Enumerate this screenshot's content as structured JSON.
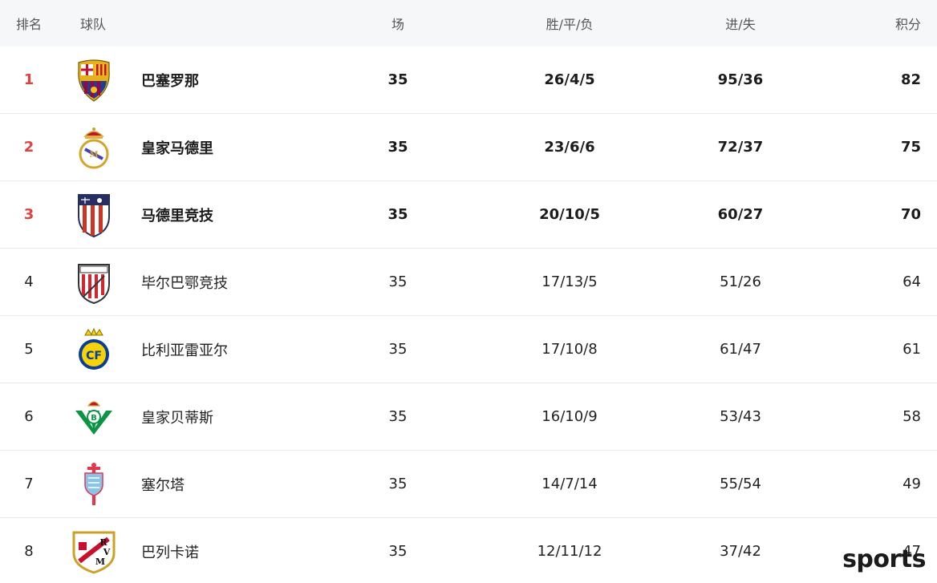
{
  "header": {
    "rank": "排名",
    "team": "球队",
    "played": "场",
    "wdl": "胜/平/负",
    "goals": "进/失",
    "points": "积分"
  },
  "rows": [
    {
      "rank": "1",
      "team": "巴塞罗那",
      "played": "35",
      "wdl": "26/4/5",
      "goals": "95/36",
      "points": "82",
      "logo": "barcelona-crest-icon"
    },
    {
      "rank": "2",
      "team": "皇家马德里",
      "played": "35",
      "wdl": "23/6/6",
      "goals": "72/37",
      "points": "75",
      "logo": "real-madrid-crest-icon"
    },
    {
      "rank": "3",
      "team": "马德里竞技",
      "played": "35",
      "wdl": "20/10/5",
      "goals": "60/27",
      "points": "70",
      "logo": "atletico-madrid-crest-icon"
    },
    {
      "rank": "4",
      "team": "毕尔巴鄂竞技",
      "played": "35",
      "wdl": "17/13/5",
      "goals": "51/26",
      "points": "64",
      "logo": "athletic-club-crest-icon"
    },
    {
      "rank": "5",
      "team": "比利亚雷亚尔",
      "played": "35",
      "wdl": "17/10/8",
      "goals": "61/47",
      "points": "61",
      "logo": "villarreal-crest-icon"
    },
    {
      "rank": "6",
      "team": "皇家贝蒂斯",
      "played": "35",
      "wdl": "16/10/9",
      "goals": "53/43",
      "points": "58",
      "logo": "real-betis-crest-icon"
    },
    {
      "rank": "7",
      "team": "塞尔塔",
      "played": "35",
      "wdl": "14/7/14",
      "goals": "55/54",
      "points": "49",
      "logo": "celta-vigo-crest-icon"
    },
    {
      "rank": "8",
      "team": "巴列卡诺",
      "played": "35",
      "wdl": "12/11/12",
      "goals": "37/42",
      "points": "47",
      "logo": "rayo-vallecano-crest-icon"
    }
  ],
  "colors": {
    "header_bg": "#f6f7f9",
    "top_rank": "#e14141",
    "divider": "#ebebeb"
  },
  "watermark": "sports"
}
